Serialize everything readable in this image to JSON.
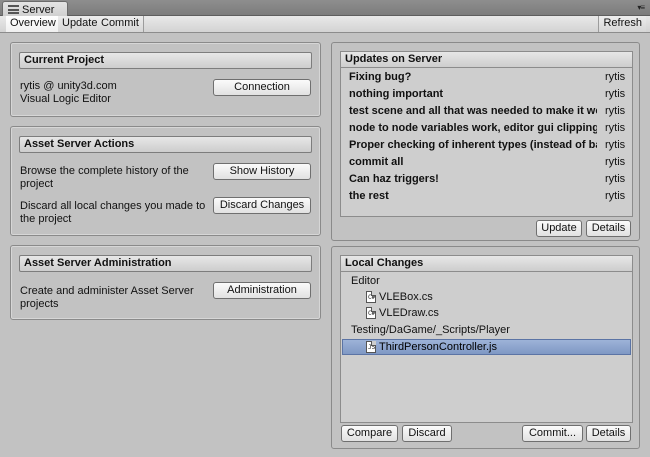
{
  "window": {
    "tab_title": "Server"
  },
  "toolbar": {
    "tabs": [
      "Overview",
      "Update",
      "Commit"
    ],
    "refresh_label": "Refresh"
  },
  "current_project": {
    "title": "Current Project",
    "user": "rytis @ unity3d.com",
    "project_name": "Visual Logic Editor",
    "connection_button": "Connection"
  },
  "actions": {
    "title": "Asset Server Actions",
    "history_text": "Browse the complete history of the project",
    "history_button": "Show History",
    "discard_text": "Discard all local changes you made to the project",
    "discard_button": "Discard Changes"
  },
  "administration": {
    "title": "Asset Server Administration",
    "text": "Create and administer Asset Server projects",
    "button": "Administration"
  },
  "updates": {
    "title": "Updates on Server",
    "rows": [
      {
        "message": "Fixing bug?",
        "author": "rytis"
      },
      {
        "message": "nothing important",
        "author": "rytis"
      },
      {
        "message": "test scene and all that was needed to make it work",
        "author": "rytis"
      },
      {
        "message": "node to node variables work, editor gui clipping",
        "author": "rytis"
      },
      {
        "message": "Proper checking of inherent types (instead of base)",
        "author": "rytis"
      },
      {
        "message": "commit all",
        "author": "rytis"
      },
      {
        "message": "Can haz triggers!",
        "author": "rytis"
      },
      {
        "message": "the rest",
        "author": "rytis"
      }
    ],
    "update_button": "Update",
    "details_button": "Details"
  },
  "local_changes": {
    "title": "Local Changes",
    "items": [
      {
        "label": "Editor",
        "type": "folder"
      },
      {
        "label": "VLEBox.cs",
        "type": "file",
        "icon": "C#"
      },
      {
        "label": "VLEDraw.cs",
        "type": "file",
        "icon": "C#"
      },
      {
        "label": "Testing/DaGame/_Scripts/Player",
        "type": "folder"
      },
      {
        "label": "ThirdPersonController.js",
        "type": "file",
        "icon": "JS"
      }
    ],
    "compare_button": "Compare",
    "discard_button": "Discard",
    "commit_button": "Commit...",
    "details_button": "Details"
  }
}
